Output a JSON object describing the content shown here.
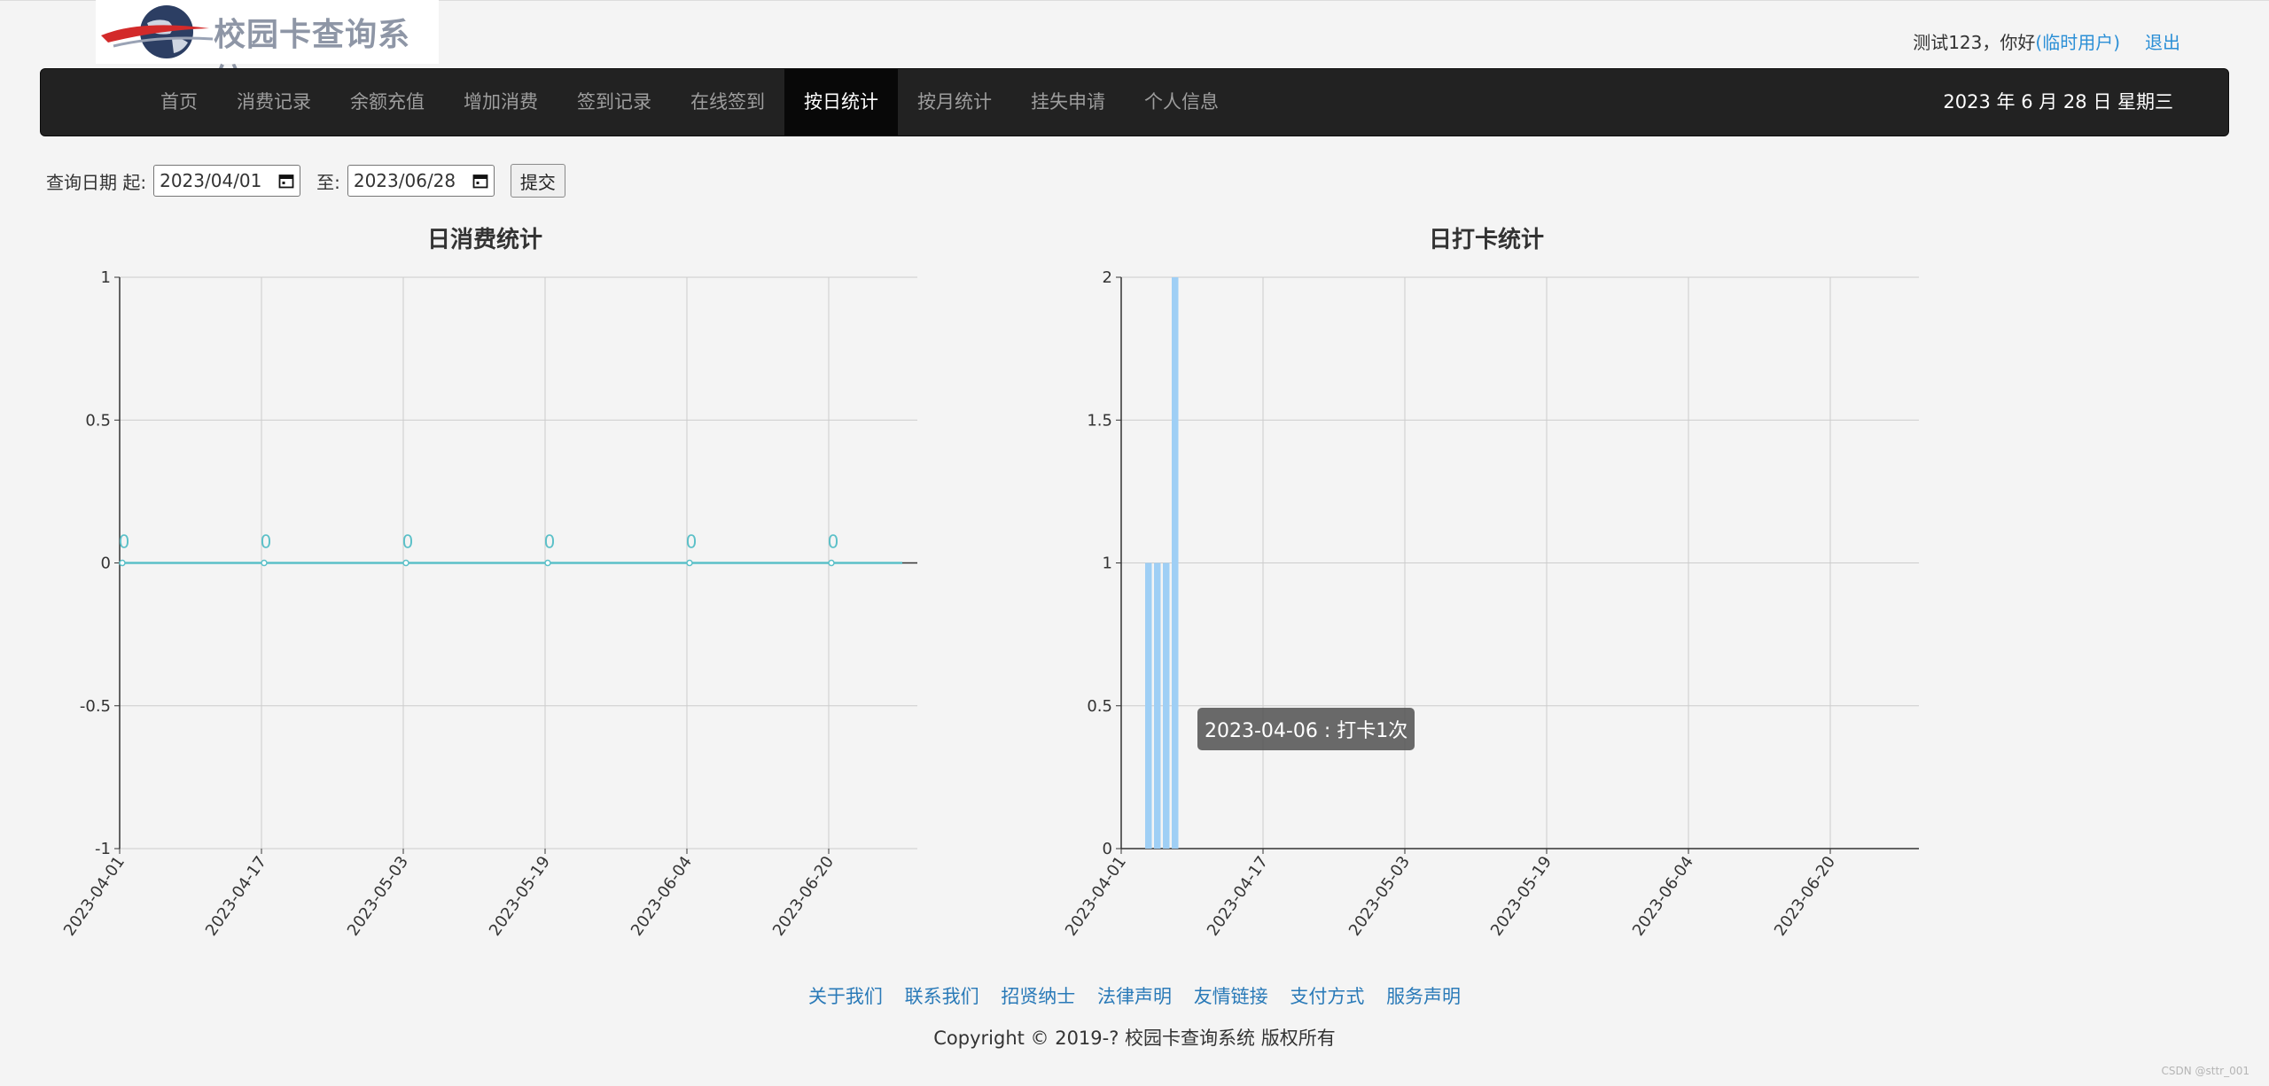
{
  "header": {
    "logo_text": "校园卡查询系统",
    "greeting": "测试123，你好",
    "user_role": "(临时用户)",
    "logout": "退出"
  },
  "nav": {
    "items": [
      {
        "label": "首页"
      },
      {
        "label": "消费记录"
      },
      {
        "label": "余额充值"
      },
      {
        "label": "增加消费"
      },
      {
        "label": "签到记录"
      },
      {
        "label": "在线签到"
      },
      {
        "label": "按日统计",
        "active": true
      },
      {
        "label": "按月统计"
      },
      {
        "label": "挂失申请"
      },
      {
        "label": "个人信息"
      }
    ],
    "date": "2023 年 6 月 28 日 星期三"
  },
  "query": {
    "label": "查询日期 起:",
    "start": "2023/04/01",
    "to_label": "至:",
    "end": "2023/06/28",
    "submit": "提交"
  },
  "chart_data": [
    {
      "type": "line",
      "title": "日消费统计",
      "x": [
        "2023-04-01",
        "2023-04-17",
        "2023-05-03",
        "2023-05-19",
        "2023-06-04",
        "2023-06-20"
      ],
      "x_ticks": [
        "2023-04-01",
        "2023-04-17",
        "2023-05-03",
        "2023-05-19",
        "2023-06-04",
        "2023-06-20"
      ],
      "y_ticks": [
        "1",
        "0.5",
        "0",
        "-0.5",
        "-1"
      ],
      "ylim": [
        -1,
        1
      ],
      "series": [
        {
          "values": [
            0,
            0,
            0,
            0,
            0,
            0
          ]
        }
      ],
      "data_labels": [
        "0",
        "0",
        "0",
        "0",
        "0",
        "0"
      ],
      "color": "#5bc0c8",
      "grid": true
    },
    {
      "type": "bar",
      "title": "日打卡统计",
      "x": [
        "2023-04-03",
        "2023-04-04",
        "2023-04-05",
        "2023-04-06"
      ],
      "x_ticks": [
        "2023-04-01",
        "2023-04-17",
        "2023-05-03",
        "2023-05-19",
        "2023-06-04",
        "2023-06-20"
      ],
      "y_ticks": [
        "2",
        "1.5",
        "1",
        "0.5",
        "0"
      ],
      "ylim": [
        0,
        2
      ],
      "series": [
        {
          "values": [
            1,
            1,
            1,
            2
          ]
        }
      ],
      "color": "#9fcff5",
      "grid": true,
      "tooltip": "2023-04-06 : 打卡1次"
    }
  ],
  "footer": {
    "links": [
      "关于我们",
      "联系我们",
      "招贤纳士",
      "法律声明",
      "友情链接",
      "支付方式",
      "服务声明"
    ],
    "copyright": "Copyright © 2019-? 校园卡查询系统 版权所有"
  },
  "watermark": "CSDN @sttr_001"
}
